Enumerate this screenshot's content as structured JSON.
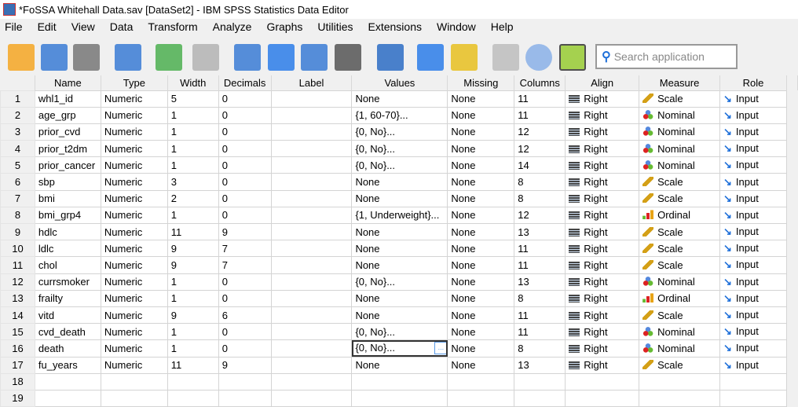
{
  "window": {
    "title": "*FoSSA Whitehall Data.sav [DataSet2] - IBM SPSS Statistics Data Editor"
  },
  "menu": [
    "File",
    "Edit",
    "View",
    "Data",
    "Transform",
    "Analyze",
    "Graphs",
    "Utilities",
    "Extensions",
    "Window",
    "Help"
  ],
  "toolbar": {
    "icons": [
      "open-folder-icon",
      "save-icon",
      "print-icon",
      "recall-dialog-icon",
      "undo-icon",
      "redo-icon",
      "goto-case-icon",
      "goto-variable-icon",
      "variables-icon",
      "descriptive-stats-icon",
      "find-icon",
      "split-file-icon",
      "select-cases-icon",
      "value-labels-icon",
      "use-variable-sets-icon",
      "add-extension-icon"
    ],
    "search_placeholder": "Search application"
  },
  "columns": [
    "Name",
    "Type",
    "Width",
    "Decimals",
    "Label",
    "Values",
    "Missing",
    "Columns",
    "Align",
    "Measure",
    "Role"
  ],
  "rows": [
    [
      "whl1_id",
      "Numeric",
      "5",
      "0",
      "",
      "None",
      "None",
      "11",
      "Right",
      "Scale",
      "Input"
    ],
    [
      "age_grp",
      "Numeric",
      "1",
      "0",
      "",
      "{1, 60-70}...",
      "None",
      "11",
      "Right",
      "Nominal",
      "Input"
    ],
    [
      "prior_cvd",
      "Numeric",
      "1",
      "0",
      "",
      "{0, No}...",
      "None",
      "12",
      "Right",
      "Nominal",
      "Input"
    ],
    [
      "prior_t2dm",
      "Numeric",
      "1",
      "0",
      "",
      "{0, No}...",
      "None",
      "12",
      "Right",
      "Nominal",
      "Input"
    ],
    [
      "prior_cancer",
      "Numeric",
      "1",
      "0",
      "",
      "{0, No}...",
      "None",
      "14",
      "Right",
      "Nominal",
      "Input"
    ],
    [
      "sbp",
      "Numeric",
      "3",
      "0",
      "",
      "None",
      "None",
      "8",
      "Right",
      "Scale",
      "Input"
    ],
    [
      "bmi",
      "Numeric",
      "2",
      "0",
      "",
      "None",
      "None",
      "8",
      "Right",
      "Scale",
      "Input"
    ],
    [
      "bmi_grp4",
      "Numeric",
      "1",
      "0",
      "",
      "{1, Underweight}...",
      "None",
      "12",
      "Right",
      "Ordinal",
      "Input"
    ],
    [
      "hdlc",
      "Numeric",
      "11",
      "9",
      "",
      "None",
      "None",
      "13",
      "Right",
      "Scale",
      "Input"
    ],
    [
      "ldlc",
      "Numeric",
      "9",
      "7",
      "",
      "None",
      "None",
      "11",
      "Right",
      "Scale",
      "Input"
    ],
    [
      "chol",
      "Numeric",
      "9",
      "7",
      "",
      "None",
      "None",
      "11",
      "Right",
      "Scale",
      "Input"
    ],
    [
      "currsmoker",
      "Numeric",
      "1",
      "0",
      "",
      "{0, No}...",
      "None",
      "13",
      "Right",
      "Nominal",
      "Input"
    ],
    [
      "frailty",
      "Numeric",
      "1",
      "0",
      "",
      "None",
      "None",
      "8",
      "Right",
      "Ordinal",
      "Input"
    ],
    [
      "vitd",
      "Numeric",
      "9",
      "6",
      "",
      "None",
      "None",
      "11",
      "Right",
      "Scale",
      "Input"
    ],
    [
      "cvd_death",
      "Numeric",
      "1",
      "0",
      "",
      "{0, No}...",
      "None",
      "11",
      "Right",
      "Nominal",
      "Input"
    ],
    [
      "death",
      "Numeric",
      "1",
      "0",
      "",
      "{0, No}...",
      "None",
      "8",
      "Right",
      "Nominal",
      "Input"
    ],
    [
      "fu_years",
      "Numeric",
      "11",
      "9",
      "",
      "None",
      "None",
      "13",
      "Right",
      "Scale",
      "Input"
    ]
  ],
  "selected_cell": {
    "row": 16,
    "column": "Values"
  },
  "total_visible_rows": 19
}
